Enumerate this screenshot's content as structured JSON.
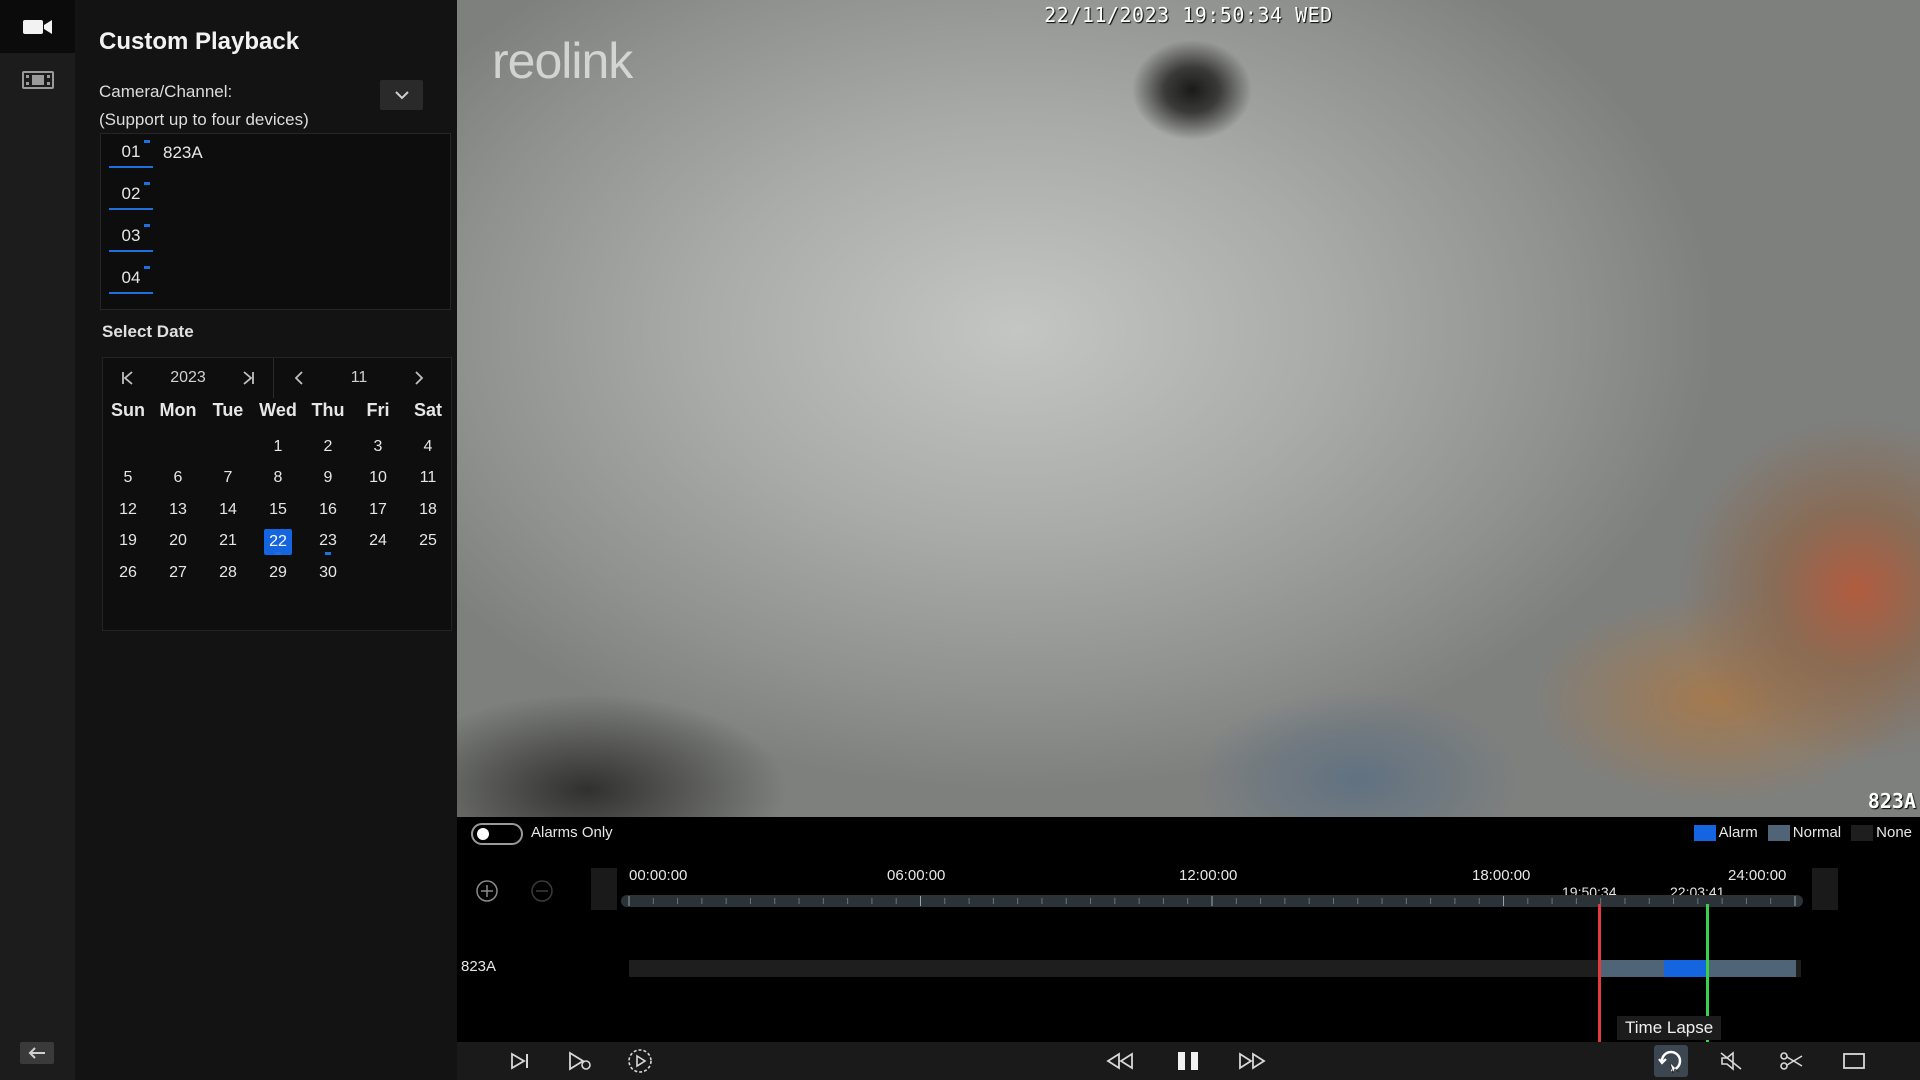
{
  "panel": {
    "title": "Custom Playback",
    "camera_label": "Camera/Channel:",
    "camera_hint": "(Support up to four devices)",
    "channels": [
      {
        "num": "01",
        "name": "823A"
      },
      {
        "num": "02",
        "name": ""
      },
      {
        "num": "03",
        "name": ""
      },
      {
        "num": "04",
        "name": ""
      }
    ],
    "select_date_label": "Select Date"
  },
  "calendar": {
    "year": "2023",
    "month": "11",
    "weekdays": [
      "Sun",
      "Mon",
      "Tue",
      "Wed",
      "Thu",
      "Fri",
      "Sat"
    ],
    "weeks": [
      [
        "",
        "",
        "",
        "1",
        "2",
        "3",
        "4"
      ],
      [
        "5",
        "6",
        "7",
        "8",
        "9",
        "10",
        "11"
      ],
      [
        "12",
        "13",
        "14",
        "15",
        "16",
        "17",
        "18"
      ],
      [
        "19",
        "20",
        "21",
        "22",
        "23",
        "24",
        "25"
      ],
      [
        "26",
        "27",
        "28",
        "29",
        "30",
        "",
        ""
      ]
    ],
    "selected_day": "22",
    "recorded_days": [
      "22",
      "23"
    ],
    "accent_color": "#1565e0"
  },
  "video": {
    "osd_timestamp": "22/11/2023 19:50:34 WED",
    "logo": "reolink",
    "camera_name": "823A"
  },
  "timeline": {
    "alarms_only_label": "Alarms Only",
    "alarms_only_on": false,
    "legend": [
      {
        "label": "Alarm",
        "color": "#1565e0"
      },
      {
        "label": "Normal",
        "color": "#4f6477"
      },
      {
        "label": "None",
        "color": "#1e1e1e"
      }
    ],
    "tick_labels": [
      "00:00:00",
      "06:00:00",
      "12:00:00",
      "18:00:00",
      "24:00:00"
    ],
    "current_time": "19:50:34",
    "marker_time": "22:03:41",
    "track_name": "823A",
    "segments": [
      {
        "type": "normal",
        "start_hour": 19.84,
        "end_hour": 23.9
      },
      {
        "type": "alarm",
        "start_hour": 21.2,
        "end_hour": 22.05
      }
    ],
    "tooltip": "Time Lapse"
  },
  "controls": {
    "active": "time-lapse"
  }
}
